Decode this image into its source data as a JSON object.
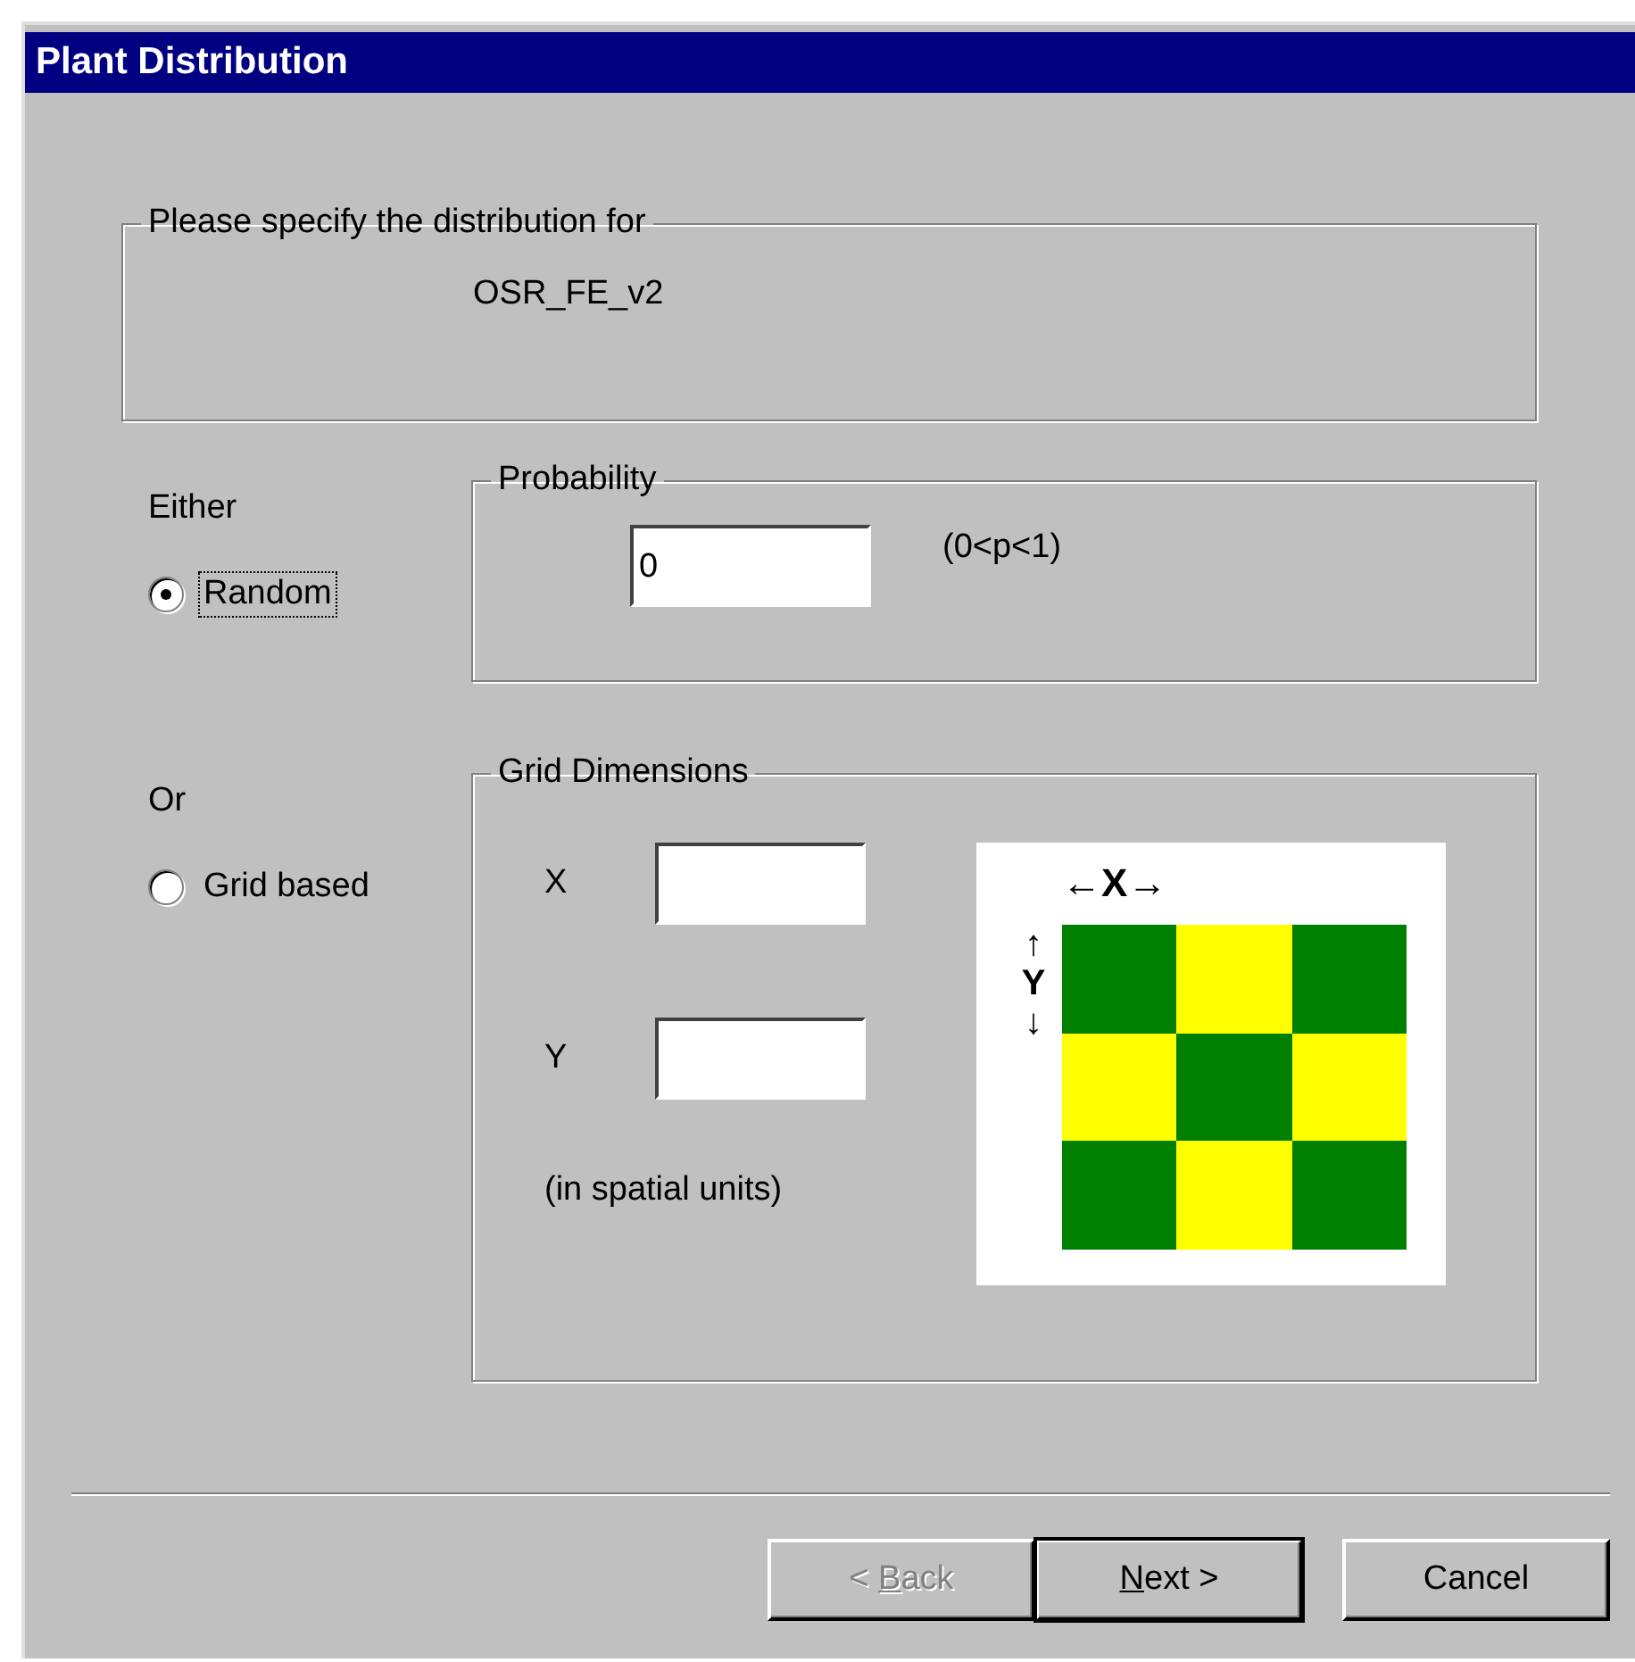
{
  "window": {
    "title": "Plant Distribution"
  },
  "target_group": {
    "legend": "Please specify the distribution for",
    "value": "OSR_FE_v2"
  },
  "options": [
    {
      "prompt": "Either",
      "label": "Random",
      "selected": true,
      "focused": true
    },
    {
      "prompt": "Or",
      "label": "Grid based",
      "selected": false,
      "focused": false
    }
  ],
  "probability": {
    "legend": "Probability",
    "value": "0",
    "hint": "(0<p<1)"
  },
  "grid_dimensions": {
    "legend": "Grid Dimensions",
    "fields": [
      {
        "label": "X"
      },
      {
        "label": "Y"
      }
    ],
    "note": "(in spatial units)",
    "diagram": {
      "x_axis": "←**X**→",
      "y_axis": "↑**Y**↓",
      "cells": [
        [
          {
            "color": "#008000"
          },
          {
            "color": "#ffff00"
          },
          {
            "color": "#008000"
          }
        ],
        [
          {
            "color": "#ffff00"
          },
          {
            "color": "#008000"
          },
          {
            "color": "#ffff00"
          }
        ],
        [
          {
            "color": "#008000"
          },
          {
            "color": "#ffff00"
          },
          {
            "color": "#008000"
          }
        ]
      ]
    }
  },
  "buttons": [
    {
      "parts": [
        {
          "text": "< ",
          "underline": false
        },
        {
          "text": "B",
          "underline": true
        },
        {
          "text": "ack",
          "underline": false
        }
      ],
      "disabled": true,
      "default": false
    },
    {
      "parts": [
        {
          "text": "N",
          "underline": true
        },
        {
          "text": "ext >",
          "underline": false
        }
      ],
      "disabled": false,
      "default": true
    },
    {
      "parts": [
        {
          "text": "Cancel",
          "underline": false
        }
      ],
      "disabled": false,
      "default": false
    }
  ]
}
